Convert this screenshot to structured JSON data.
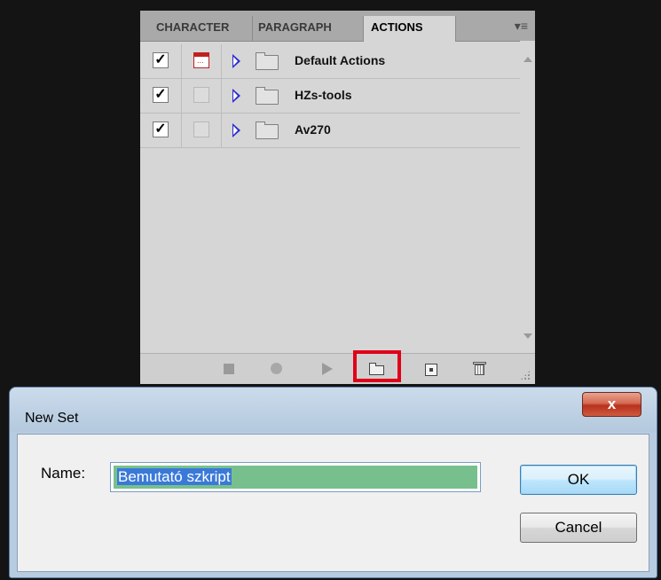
{
  "panel": {
    "tabs": [
      {
        "label": "CHARACTER"
      },
      {
        "label": "PARAGRAPH"
      },
      {
        "label": "ACTIONS"
      }
    ],
    "active_tab": "ACTIONS",
    "menu_icon": "panel-menu-icon",
    "action_sets": [
      {
        "name": "Default Actions",
        "checked": true,
        "dialog_toggle": "red"
      },
      {
        "name": "HZs-tools",
        "checked": true,
        "dialog_toggle": "empty"
      },
      {
        "name": "Av270",
        "checked": true,
        "dialog_toggle": "empty"
      }
    ],
    "bottom_buttons": [
      "stop-icon",
      "record-icon",
      "play-icon",
      "new-set-icon",
      "new-action-icon",
      "delete-icon"
    ],
    "highlight_color": "#e0001a"
  },
  "dialog": {
    "title": "New Set",
    "close_label": "x",
    "name_label": "Name:",
    "name_value": "Bemutató szkript",
    "ok_label": "OK",
    "cancel_label": "Cancel"
  }
}
